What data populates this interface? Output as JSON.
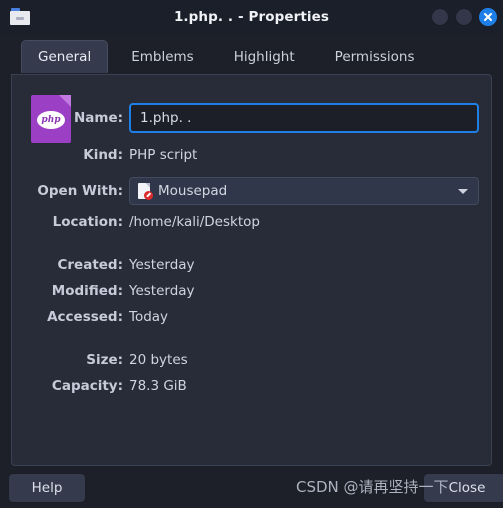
{
  "window": {
    "title": "1.php. . - Properties",
    "icon": "folder-icon",
    "controls": {
      "minimize": "minimize-button",
      "maximize": "maximize-button",
      "close": "close-window-button"
    }
  },
  "tabs": [
    {
      "label": "General",
      "active": true
    },
    {
      "label": "Emblems",
      "active": false
    },
    {
      "label": "Highlight",
      "active": false
    },
    {
      "label": "Permissions",
      "active": false
    }
  ],
  "general": {
    "file_icon": "php-file-icon",
    "file_icon_text": "php",
    "name": {
      "label": "Name:",
      "value": "1.php. .",
      "placeholder": "1.php. ."
    },
    "kind": {
      "label": "Kind:",
      "value": "PHP script"
    },
    "open_with": {
      "label": "Open With:",
      "value": "Mousepad",
      "icon": "mousepad-icon",
      "arrow": "chevron-down-icon"
    },
    "location": {
      "label": "Location:",
      "value": "/home/kali/Desktop"
    },
    "created": {
      "label": "Created:",
      "value": "Yesterday"
    },
    "modified": {
      "label": "Modified:",
      "value": "Yesterday"
    },
    "accessed": {
      "label": "Accessed:",
      "value": "Today"
    },
    "size": {
      "label": "Size:",
      "value": "20 bytes"
    },
    "capacity": {
      "label": "Capacity:",
      "value": "78.3 GiB"
    }
  },
  "footer": {
    "help_label": "Help",
    "close_label": "Close"
  },
  "watermark": "CSDN @请再坚持一下",
  "colors": {
    "window_bg": "#1d2029",
    "titlebar_bg": "#1b1f29",
    "panel_bg": "#282c39",
    "accent_blue": "#1e7fe8",
    "php_purple": "#9b3fc4",
    "text": "#cfd4e0"
  }
}
